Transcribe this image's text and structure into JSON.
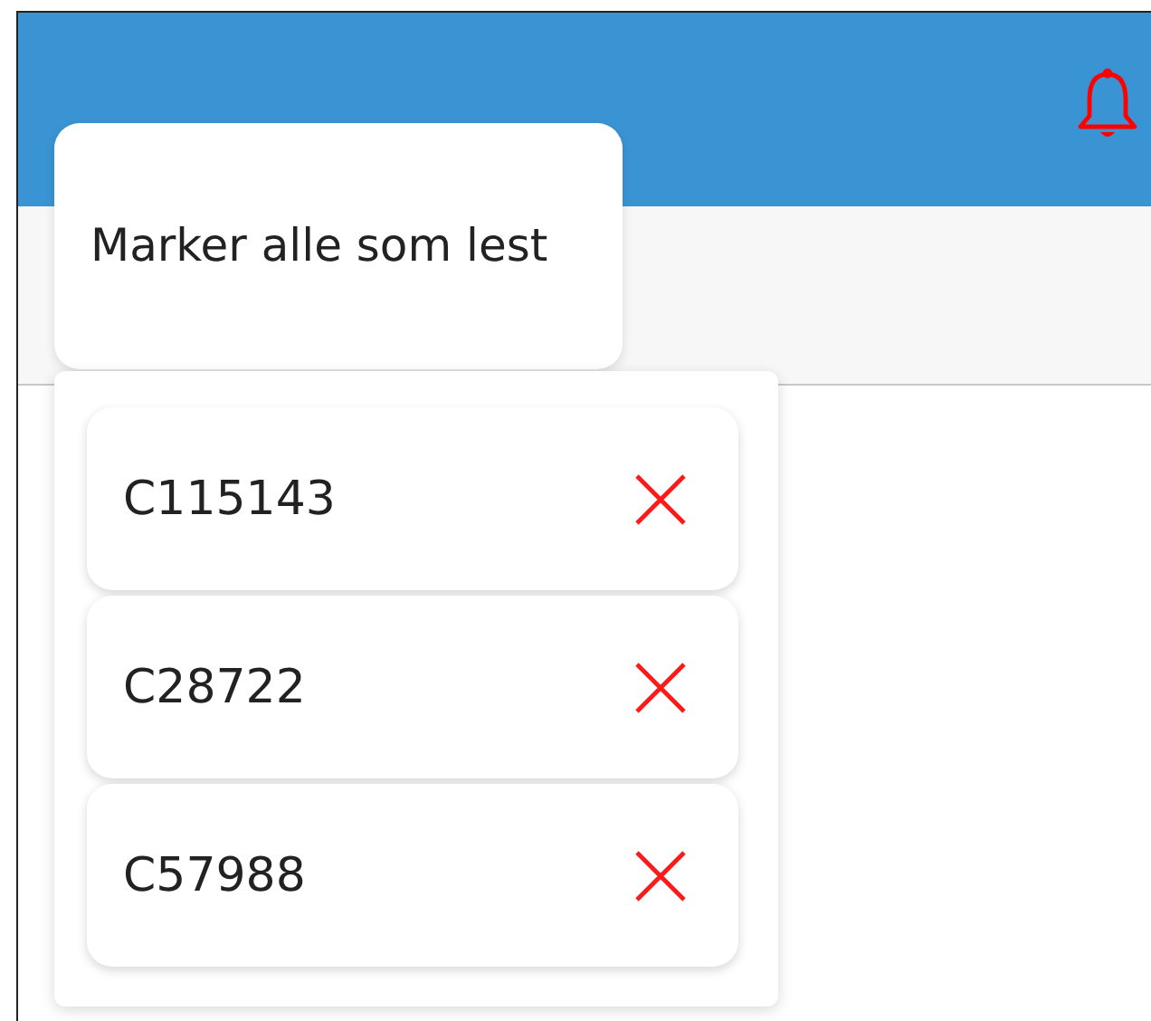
{
  "header": {
    "notification_icon_active": true
  },
  "popover": {
    "label": "Marker alle som lest"
  },
  "notifications": [
    {
      "id_text": "C115143"
    },
    {
      "id_text": "C28722"
    },
    {
      "id_text": "C57988"
    }
  ]
}
